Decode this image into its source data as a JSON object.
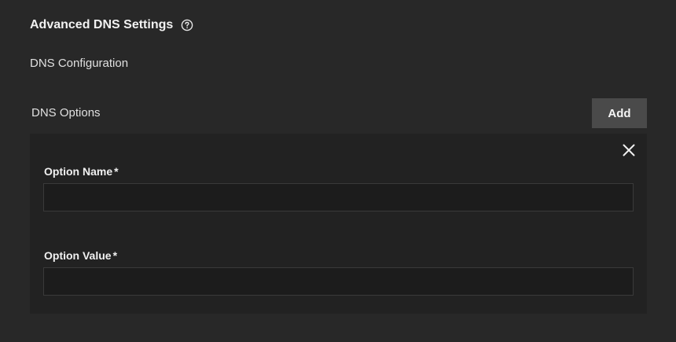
{
  "section": {
    "title": "Advanced DNS Settings",
    "help_icon": "help-circle-icon"
  },
  "subsection": {
    "title": "DNS Configuration"
  },
  "dns_options": {
    "label": "DNS Options",
    "add_label": "Add",
    "items": [
      {
        "close_icon": "close-icon",
        "option_name": {
          "label": "Option Name",
          "required_mark": "*",
          "value": ""
        },
        "option_value": {
          "label": "Option Value",
          "required_mark": "*",
          "value": ""
        }
      }
    ]
  },
  "colors": {
    "background": "#282828",
    "card": "#222222",
    "input": "#1c1c1c",
    "button": "#4a4a4a",
    "text": "#e6e6e6"
  }
}
